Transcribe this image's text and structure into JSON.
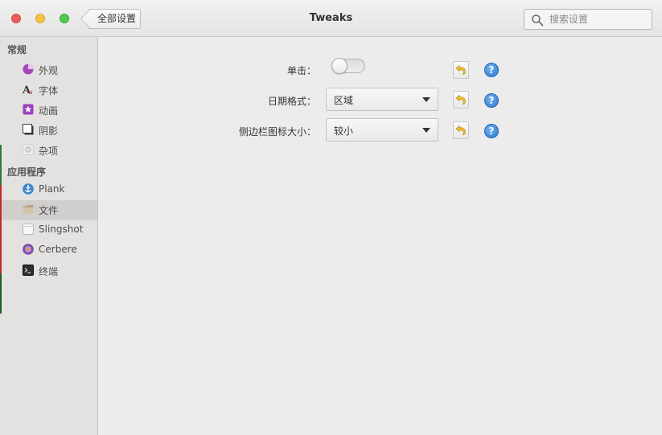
{
  "window": {
    "title": "Tweaks"
  },
  "header": {
    "back_label": "全部设置",
    "search_placeholder": "搜索设置"
  },
  "sidebar": {
    "sections": [
      {
        "header": "常规",
        "items": [
          {
            "label": "外观",
            "icon": "appearance-icon"
          },
          {
            "label": "字体",
            "icon": "fonts-icon"
          },
          {
            "label": "动画",
            "icon": "animation-icon"
          },
          {
            "label": "阴影",
            "icon": "shadow-icon"
          },
          {
            "label": "杂项",
            "icon": "misc-icon"
          }
        ]
      },
      {
        "header": "应用程序",
        "items": [
          {
            "label": "Plank",
            "icon": "plank-icon"
          },
          {
            "label": "文件",
            "icon": "files-icon",
            "selected": true
          },
          {
            "label": "Slingshot",
            "icon": "slingshot-icon"
          },
          {
            "label": "Cerbere",
            "icon": "cerbere-icon"
          },
          {
            "label": "终端",
            "icon": "terminal-icon"
          }
        ]
      }
    ]
  },
  "settings": [
    {
      "label": "单击：",
      "type": "switch",
      "on": false
    },
    {
      "label": "日期格式：",
      "type": "combo",
      "value": "区域"
    },
    {
      "label": "侧边栏图标大小：",
      "type": "combo",
      "value": "较小"
    }
  ],
  "help_glyph": "?",
  "colors": {
    "close": "#ed5d5a",
    "minimize": "#f6c343",
    "maximize": "#4fcb4c",
    "help": "#2d77cf",
    "selected_row": "#d0cfcd"
  }
}
